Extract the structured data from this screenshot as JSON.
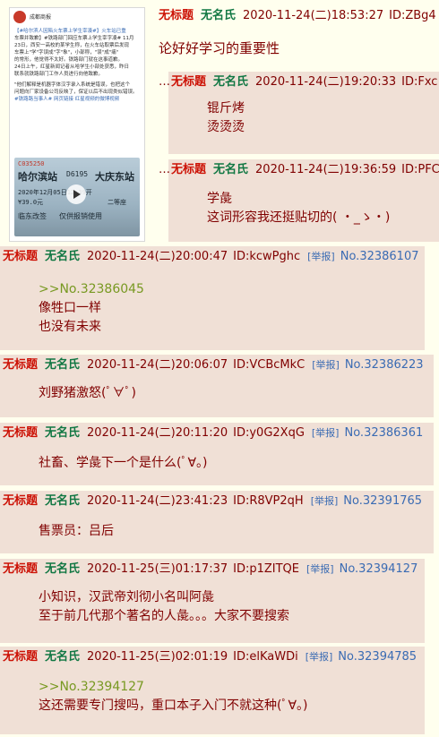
{
  "thumbnail": {
    "source": "成都商报",
    "text_lines": [
      "【#哈尔滨人因陷火车票上学生宰凑#】火车站已重",
      "车票并致歉】#铁路部门回应车票上学生宰字凑# 11月",
      "23日，西安一高校的某学生称，在火车站取票后发现",
      "车票上\"学\"字误成\"字\"象\"，小部称，\"误\"成\"痛\"",
      "的常形，他觉得不太好。铁路部门就在这事道歉。",
      "24日上午，红星新闻记者从哈学生小部处获悉，昨日",
      "联系就铁路部门工作人员进行向他致歉。",
      "\"他们解释是机器字体汉字录入系统是错误，也把这个",
      "问题向厂家设备公司反映了，保证以后不出现类似错误。",
      "#铁路路当事人# 网页链接 红星视频的微博视频"
    ],
    "ticket": {
      "code": "C035250",
      "from": "哈尔滨站",
      "train": "D6195",
      "to": "大庆东站",
      "date": "2020年12月05日12:39开",
      "price": "¥39.0元",
      "seat": "二等座",
      "note": "仅供报销使用",
      "reason": "临东改签"
    }
  },
  "op": {
    "title": "无标题",
    "name": "无名氏",
    "time": "2020-11-24(二)18:53:27",
    "uid": "ID:ZBg4",
    "content": "论好好学习的重要性"
  },
  "inner_replies": [
    {
      "title": "无标题",
      "name": "无名氏",
      "time": "2020-11-24(二)19:20:33",
      "uid": "ID:Fxc",
      "lines": [
        "锟斤烤",
        "烫烫烫"
      ]
    },
    {
      "title": "无标题",
      "name": "无名氏",
      "time": "2020-11-24(二)19:36:59",
      "uid": "ID:PFC",
      "lines": [
        "学彘",
        "这词形容我还挺贴切的( ・_ゝ・)"
      ]
    }
  ],
  "dots": "…",
  "report_label": "[举报]",
  "replies": [
    {
      "title": "无标题",
      "name": "无名氏",
      "time": "2020-11-24(二)20:00:47",
      "uid": "ID:kcwPghc",
      "no": "No.32386107",
      "quote": ">>No.32386045",
      "lines": [
        "像牲口一样",
        "也没有未来"
      ]
    },
    {
      "title": "无标题",
      "name": "无名氏",
      "time": "2020-11-24(二)20:06:07",
      "uid": "ID:VCBcMkC",
      "no": "No.32386223",
      "quote": "",
      "lines": [
        "刘野猪激怒(ﾟ∀ﾟ)"
      ]
    },
    {
      "title": "无标题",
      "name": "无名氏",
      "time": "2020-11-24(二)20:11:20",
      "uid": "ID:y0G2XqG",
      "no": "No.32386361",
      "quote": "",
      "lines": [
        "社畜、学彘下一个是什么(ﾟ∀。)"
      ]
    },
    {
      "title": "无标题",
      "name": "无名氏",
      "time": "2020-11-24(二)23:41:23",
      "uid": "ID:R8VP2qH",
      "no": "No.32391765",
      "quote": "",
      "lines": [
        "售票员：吕后"
      ]
    },
    {
      "title": "无标题",
      "name": "无名氏",
      "time": "2020-11-25(三)01:17:37",
      "uid": "ID:p1ZITQE",
      "no": "No.32394127",
      "quote": "",
      "lines": [
        "小知识，汉武帝刘彻小名叫阿彘",
        "至于前几代那个著名的人彘。。。大家不要搜索"
      ]
    },
    {
      "title": "无标题",
      "name": "无名氏",
      "time": "2020-11-25(三)02:01:19",
      "uid": "ID:elKaWDi",
      "no": "No.32394785",
      "quote": ">>No.32394127",
      "lines": [
        "这还需要专门搜吗，重口本子入门不就这种(ﾟ∀。)"
      ]
    }
  ]
}
